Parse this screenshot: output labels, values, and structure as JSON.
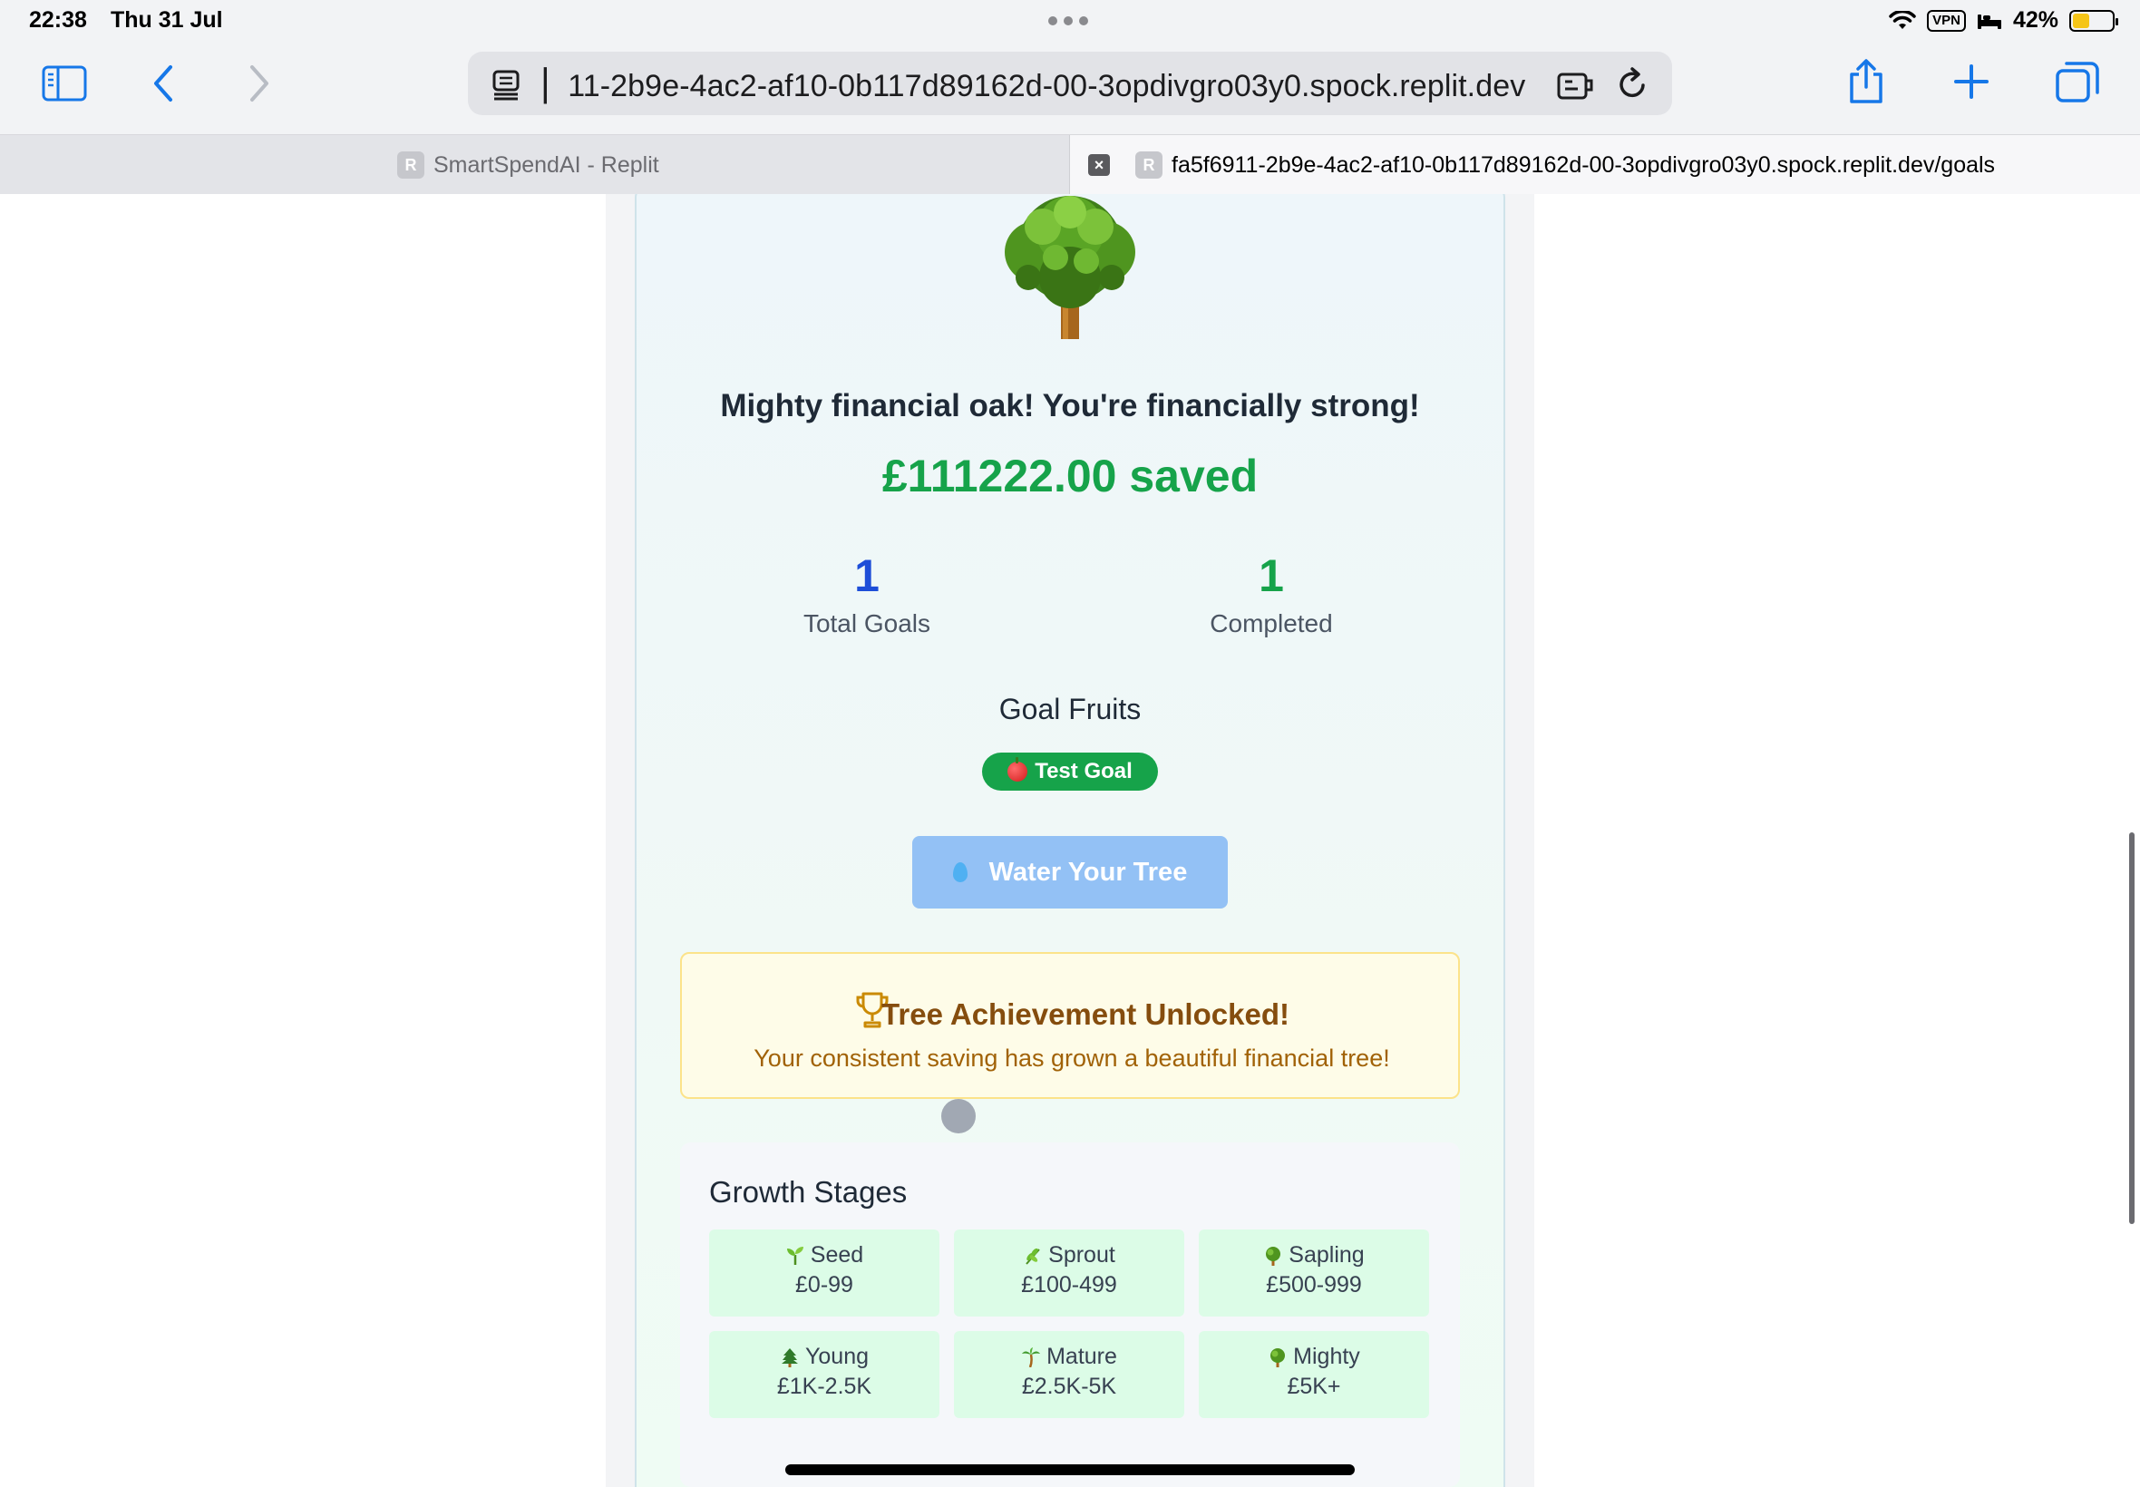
{
  "status_bar": {
    "time": "22:38",
    "date": "Thu 31 Jul",
    "vpn": "VPN",
    "battery": "42%",
    "battery_level": 0.42
  },
  "browser": {
    "url": "▏11-2b9e-4ac2-af10-0b117d89162d-00-3opdivgro03y0.spock.replit.dev",
    "tabs": [
      {
        "favicon": "R",
        "title": "SmartSpendAI - Replit"
      },
      {
        "favicon": "R",
        "title": "fa5f6911-2b9e-4ac2-af10-0b117d89162d-00-3opdivgro03y0.spock.replit.dev/goals"
      }
    ],
    "icons": [
      "sidebar-icon",
      "back-icon",
      "forward-icon",
      "reader-icon",
      "extension-icon",
      "reload-icon",
      "share-icon",
      "new-tab-icon",
      "tabs-overview-icon"
    ]
  },
  "tree_card": {
    "headline": "Mighty financial oak! You're financially strong!",
    "saved": "£111222.00 saved",
    "stats": [
      {
        "value": "1",
        "label": "Total Goals",
        "color": "#1d4ed8"
      },
      {
        "value": "1",
        "label": "Completed",
        "color": "#16a34a"
      }
    ],
    "fruits_title": "Goal Fruits",
    "fruits": [
      {
        "label": "Test Goal",
        "icon": "apple-icon"
      }
    ],
    "water_button": "Water Your Tree",
    "achievement": {
      "title": "Tree Achievement Unlocked!",
      "subtitle": "Your consistent saving has grown a beautiful financial tree!"
    },
    "growth_stages": {
      "title": "Growth Stages",
      "stages": [
        {
          "name": "Seed",
          "range": "£0-99",
          "icon": "seedling-icon"
        },
        {
          "name": "Sprout",
          "range": "£100-499",
          "icon": "herb-icon"
        },
        {
          "name": "Sapling",
          "range": "£500-999",
          "icon": "tree-icon"
        },
        {
          "name": "Young",
          "range": "£1K-2.5K",
          "icon": "evergreen-icon"
        },
        {
          "name": "Mature",
          "range": "£2.5K-5K",
          "icon": "palm-tree-icon"
        },
        {
          "name": "Mighty",
          "range": "£5K+",
          "icon": "tree-icon"
        }
      ]
    }
  },
  "colors": {
    "accent_green": "#16a34a",
    "accent_blue": "#1d4ed8",
    "button_blue": "#93c1f5",
    "safari_blue": "#1677e8"
  }
}
